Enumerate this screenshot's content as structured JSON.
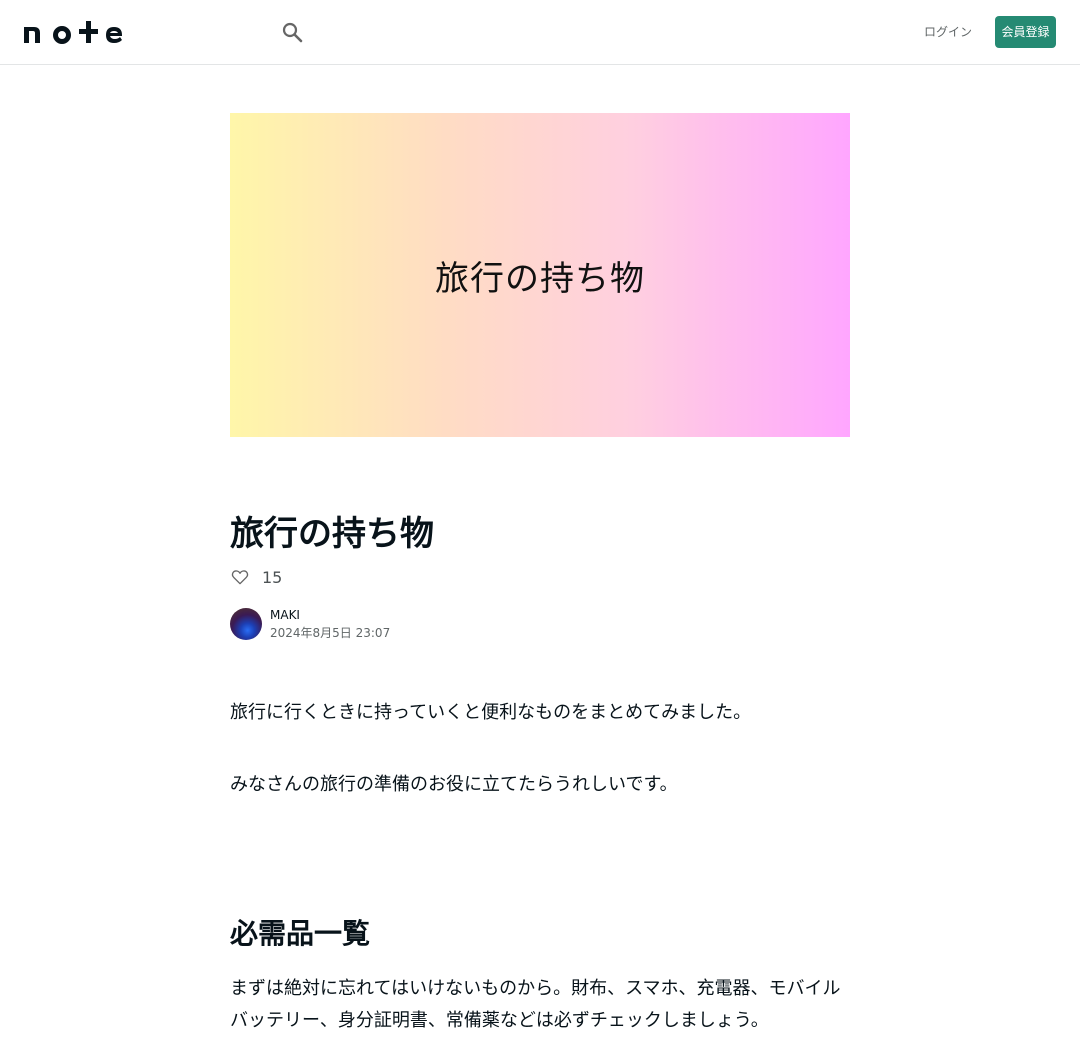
{
  "header": {
    "logo_text": "note",
    "search_icon": "search-icon",
    "login_label": "ログイン",
    "signup_label": "会員登録",
    "brand_color": "#258a73"
  },
  "hero": {
    "text": "旅行の持ち物"
  },
  "article": {
    "title": "旅行の持ち物",
    "likes": "15",
    "author": "MAKI",
    "date": "2024年8月5日 23:07",
    "paragraphs": [
      "旅行に行くときに持っていくと便利なものをまとめてみました。",
      "みなさんの旅行の準備のお役に立てたらうれしいです。"
    ],
    "section_heading": "必需品一覧",
    "section_text": "まずは絶対に忘れてはいけないものから。財布、スマホ、充電器、モバイルバッテリー、身分証明書、常備薬などは必ずチェックしましょう。"
  }
}
